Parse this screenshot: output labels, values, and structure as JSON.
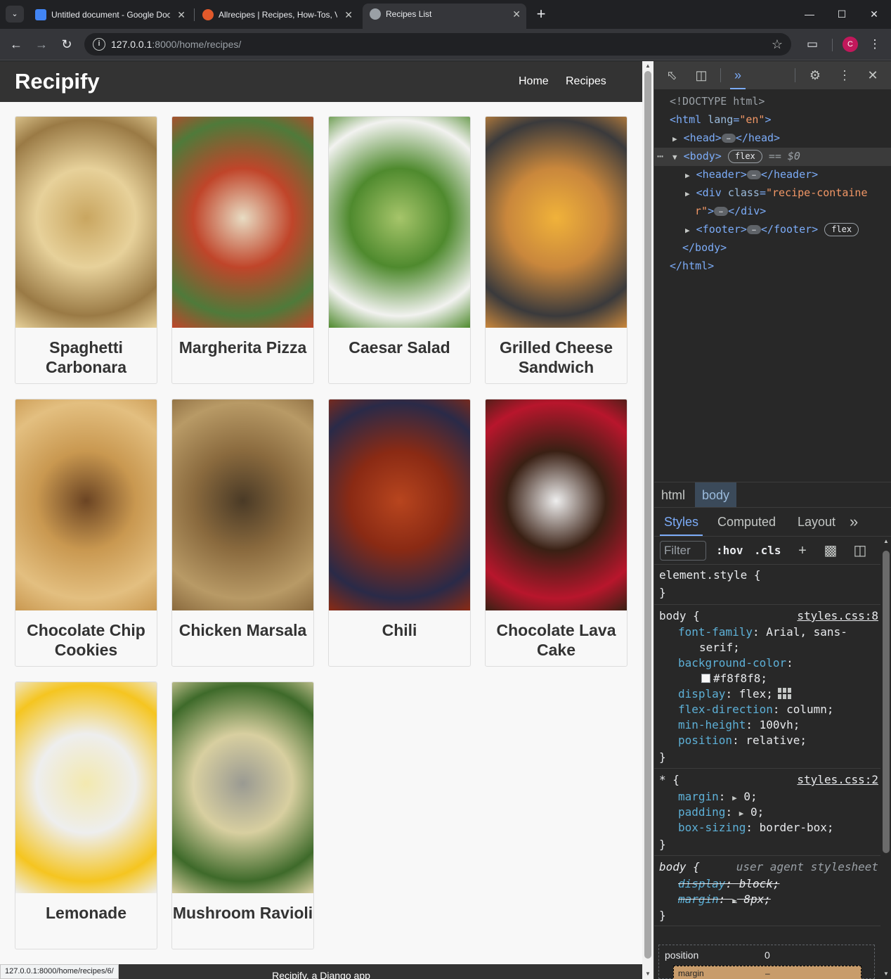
{
  "browser": {
    "tabs": [
      {
        "title": "Untitled document - Google Docs",
        "favicon": "google-docs-icon",
        "color": "#4285f4"
      },
      {
        "title": "Allrecipes | Recipes, How-Tos, Videos",
        "favicon": "allrecipes-icon",
        "color": "#e1592b"
      },
      {
        "title": "Recipes List",
        "favicon": "globe-icon",
        "color": "#9aa0a6"
      }
    ],
    "url_host": "127.0.0.1",
    "url_path": ":8000/home/recipes/",
    "profile_initial": "C",
    "status_url": "127.0.0.1:8000/home/recipes/6/"
  },
  "site": {
    "brand": "Recipify",
    "nav": [
      "Home",
      "Recipes"
    ],
    "recipes": [
      {
        "name": "Spaghetti Carbonara",
        "image": "spaghetti-photo",
        "colors": [
          "#e7d19a",
          "#c9a660",
          "#9a7a45"
        ]
      },
      {
        "name": "Margherita Pizza",
        "image": "pizza-photo",
        "colors": [
          "#c0452a",
          "#e8dcc3",
          "#4f7a3a"
        ]
      },
      {
        "name": "Caesar Salad",
        "image": "salad-photo",
        "colors": [
          "#4f8a2e",
          "#a6c56a",
          "#f2f2f0"
        ]
      },
      {
        "name": "Grilled Cheese Sandwich",
        "image": "grilled-cheese-photo",
        "colors": [
          "#c9873c",
          "#f0b23a",
          "#3a3a3c"
        ]
      },
      {
        "name": "Chocolate Chip Cookies",
        "image": "cookies-photo",
        "colors": [
          "#c99850",
          "#6b4423",
          "#e3bf80"
        ]
      },
      {
        "name": "Chicken Marsala",
        "image": "chicken-marsala-photo",
        "colors": [
          "#8a6a3e",
          "#4a3a26",
          "#b89a66"
        ]
      },
      {
        "name": "Chili",
        "image": "chili-photo",
        "colors": [
          "#8a2a14",
          "#b8451e",
          "#2a2a48"
        ]
      },
      {
        "name": "Chocolate Lava Cake",
        "image": "lava-cake-photo",
        "colors": [
          "#3a2014",
          "#eeeeee",
          "#b8162c"
        ]
      },
      {
        "name": "Lemonade",
        "image": "lemonade-photo",
        "colors": [
          "#eeeeee",
          "#f3e9b0",
          "#f5c520"
        ]
      },
      {
        "name": "Mushroom Ravioli",
        "image": "ravioli-photo",
        "colors": [
          "#d8cfa0",
          "#9a9a92",
          "#3e6a2a"
        ]
      }
    ],
    "footer": "Recipify, a Django app"
  },
  "devtools": {
    "doctype": "<!DOCTYPE html>",
    "elements": {
      "html_open": "<html",
      "lang_attr": "lang",
      "lang_val": "\"en\"",
      "head": "<head>",
      "head_close": "</head>",
      "body": "<body>",
      "flex_badge": "flex",
      "eq_dollar": "== $0",
      "header": "<header>",
      "header_close": "</header>",
      "div_open": "<div",
      "class_attr": "class",
      "class_val_1": "\"recipe-containe",
      "class_val_2": "r\"",
      "div_close": "</div>",
      "footer": "<footer>",
      "footer_close": "</footer>",
      "body_close": "</body>",
      "html_close": "</html>"
    },
    "breadcrumbs": [
      "html",
      "body"
    ],
    "style_tabs": [
      "Styles",
      "Computed",
      "Layout"
    ],
    "filter_placeholder": "Filter",
    "hov": ":hov",
    "cls": ".cls",
    "rules": {
      "element_style": "element.style {",
      "close_brace": "}",
      "body_sel": "body {",
      "body_src": "styles.css:8",
      "font_family_prop": "font-family",
      "font_family_val": "Arial, sans-",
      "font_family_val2": "serif;",
      "bg_prop": "background-color",
      "bg_val": "#f8f8f8;",
      "display_prop": "display",
      "display_val": "flex;",
      "flexdir_prop": "flex-direction",
      "flexdir_val": "column;",
      "minh_prop": "min-height",
      "minh_val": "100vh;",
      "pos_prop": "position",
      "pos_val": "relative;",
      "star_sel": "* {",
      "star_src": "styles.css:2",
      "margin_prop": "margin",
      "margin_val": "0;",
      "padding_prop": "padding",
      "padding_val": "0;",
      "boxsizing_prop": "box-sizing",
      "boxsizing_val": "border-box;",
      "ua_sel": "body {",
      "ua_src": "user agent stylesheet",
      "ua_display_prop": "display",
      "ua_display_val": "block;",
      "ua_margin_prop": "margin",
      "ua_margin_val": "8px;"
    },
    "boxmodel": {
      "label": "position",
      "value": "0",
      "margin_label": "margin",
      "margin_value": "–"
    }
  }
}
